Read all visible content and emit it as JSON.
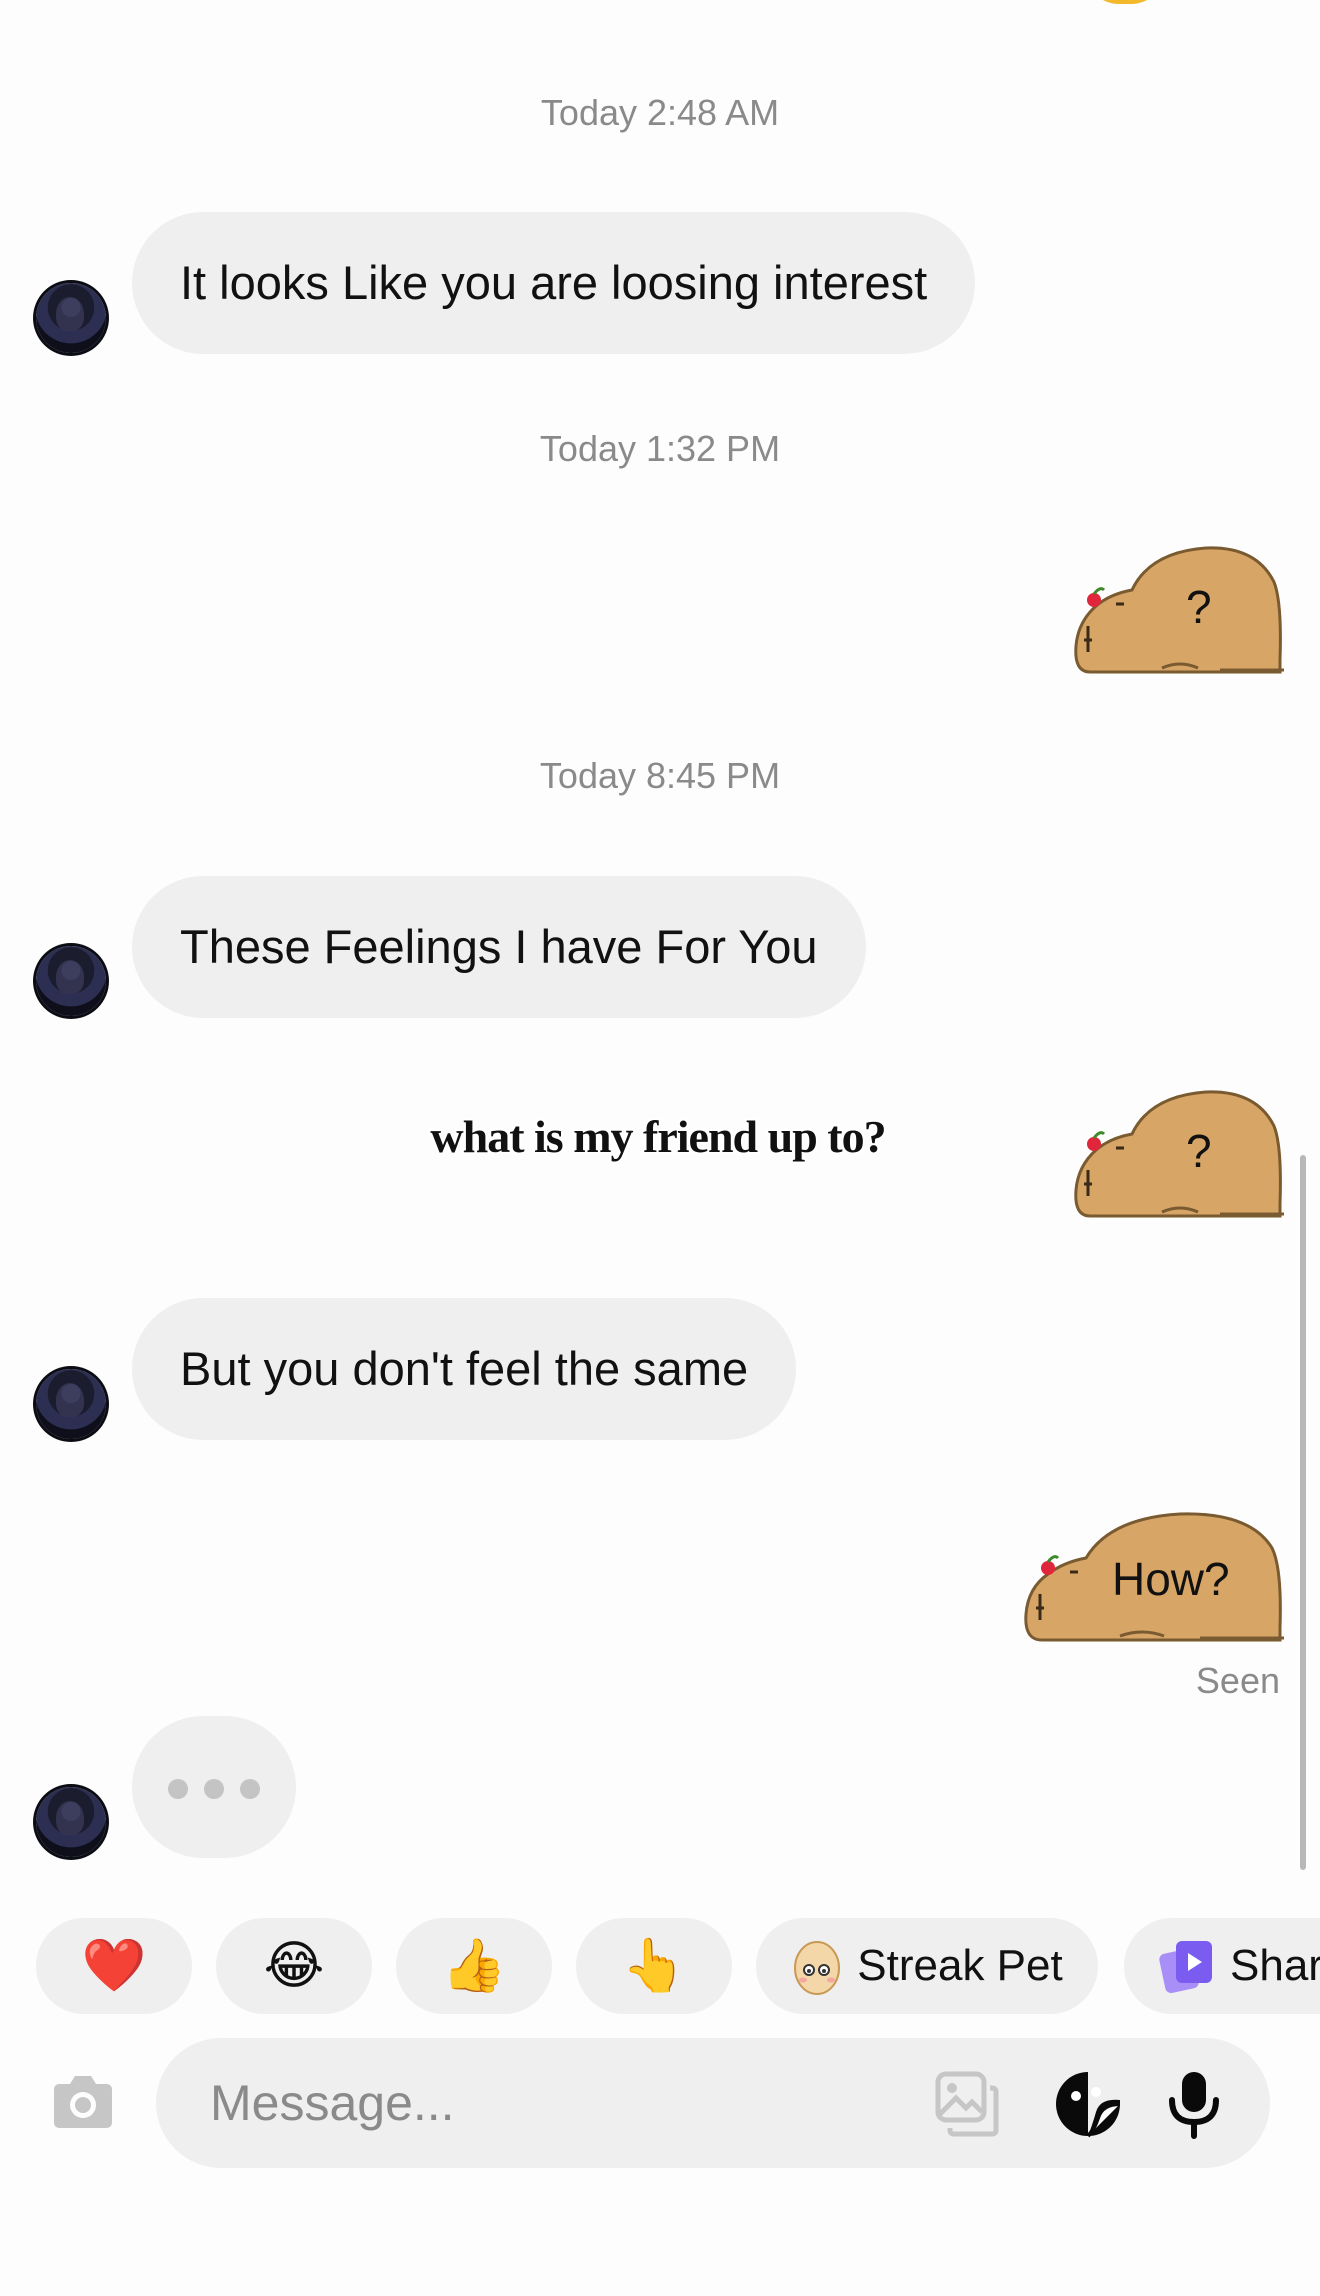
{
  "thread": {
    "messages": [
      {
        "type": "timestamp",
        "text": "Today 2:48 AM"
      },
      {
        "type": "incoming",
        "text": "It looks Like you are loosing interest"
      },
      {
        "type": "timestamp",
        "text": "Today 1:32 PM"
      },
      {
        "type": "outgoing-sticker",
        "sticker": "capybara",
        "text": "?"
      },
      {
        "type": "timestamp",
        "text": "Today 8:45 PM"
      },
      {
        "type": "incoming",
        "text": "These Feelings I have For You"
      },
      {
        "type": "outgoing-sticker",
        "sticker": "capybara",
        "text": "?"
      },
      {
        "type": "incoming",
        "text": "But you don't feel the same"
      },
      {
        "type": "outgoing-sticker",
        "sticker": "capybara",
        "text": "How?"
      }
    ],
    "overlay_caption": "what is my friend up to?",
    "seen_label": "Seen",
    "typing_indicator": true
  },
  "quick_reactions": [
    {
      "emoji": "❤️",
      "icon": "red-heart-emoji"
    },
    {
      "emoji": "😂",
      "icon": "tears-of-joy-emoji"
    },
    {
      "emoji": "👍",
      "icon": "thumbs-up-emoji"
    },
    {
      "emoji": "👆",
      "icon": "pointing-up-emoji"
    }
  ],
  "chips": [
    {
      "label": "Streak Pet",
      "icon": "egg-icon"
    },
    {
      "label": "Shar",
      "icon": "share-icon"
    }
  ],
  "composer": {
    "placeholder": "Message...",
    "icons": [
      "camera-icon",
      "gallery-icon",
      "sticker-icon",
      "microphone-icon"
    ]
  },
  "colors": {
    "bubble_incoming": "#efefef",
    "sticker_body": "#d7a566",
    "sticker_outline": "#7a5a30",
    "share_accent": "#7a5cf0"
  }
}
